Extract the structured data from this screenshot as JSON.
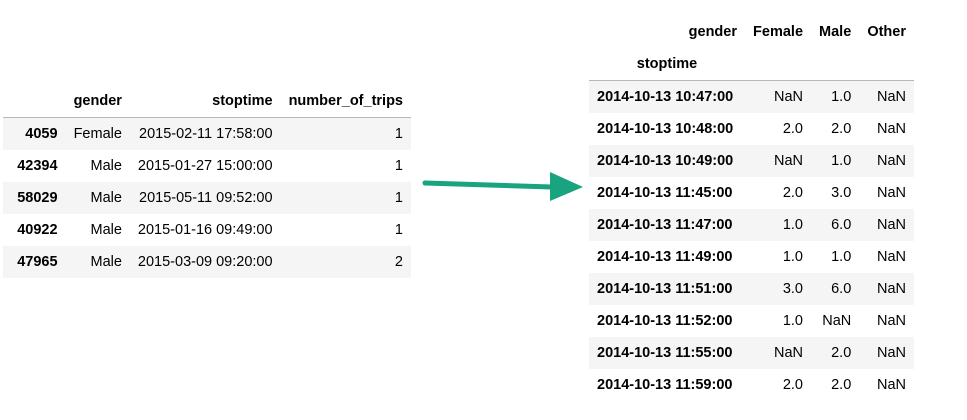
{
  "left_df": {
    "columns": [
      "gender",
      "stoptime",
      "number_of_trips"
    ],
    "rows": [
      {
        "index": "4059",
        "gender": "Female",
        "stoptime": "2015-02-11 17:58:00",
        "number_of_trips": "1"
      },
      {
        "index": "42394",
        "gender": "Male",
        "stoptime": "2015-01-27 15:00:00",
        "number_of_trips": "1"
      },
      {
        "index": "58029",
        "gender": "Male",
        "stoptime": "2015-05-11 09:52:00",
        "number_of_trips": "1"
      },
      {
        "index": "40922",
        "gender": "Male",
        "stoptime": "2015-01-16 09:49:00",
        "number_of_trips": "1"
      },
      {
        "index": "47965",
        "gender": "Male",
        "stoptime": "2015-03-09 09:20:00",
        "number_of_trips": "2"
      }
    ]
  },
  "right_df": {
    "columns_name": "gender",
    "columns": [
      "Female",
      "Male",
      "Other"
    ],
    "index_name": "stoptime",
    "rows": [
      {
        "index": "2014-10-13 10:47:00",
        "values": [
          "NaN",
          "1.0",
          "NaN"
        ]
      },
      {
        "index": "2014-10-13 10:48:00",
        "values": [
          "2.0",
          "2.0",
          "NaN"
        ]
      },
      {
        "index": "2014-10-13 10:49:00",
        "values": [
          "NaN",
          "1.0",
          "NaN"
        ]
      },
      {
        "index": "2014-10-13 11:45:00",
        "values": [
          "2.0",
          "3.0",
          "NaN"
        ]
      },
      {
        "index": "2014-10-13 11:47:00",
        "values": [
          "1.0",
          "6.0",
          "NaN"
        ]
      },
      {
        "index": "2014-10-13 11:49:00",
        "values": [
          "1.0",
          "1.0",
          "NaN"
        ]
      },
      {
        "index": "2014-10-13 11:51:00",
        "values": [
          "3.0",
          "6.0",
          "NaN"
        ]
      },
      {
        "index": "2014-10-13 11:52:00",
        "values": [
          "1.0",
          "NaN",
          "NaN"
        ]
      },
      {
        "index": "2014-10-13 11:55:00",
        "values": [
          "NaN",
          "2.0",
          "NaN"
        ]
      },
      {
        "index": "2014-10-13 11:59:00",
        "values": [
          "2.0",
          "2.0",
          "NaN"
        ]
      }
    ]
  },
  "arrow": {
    "icon": "arrow-right-icon",
    "color": "#1aa37f"
  }
}
